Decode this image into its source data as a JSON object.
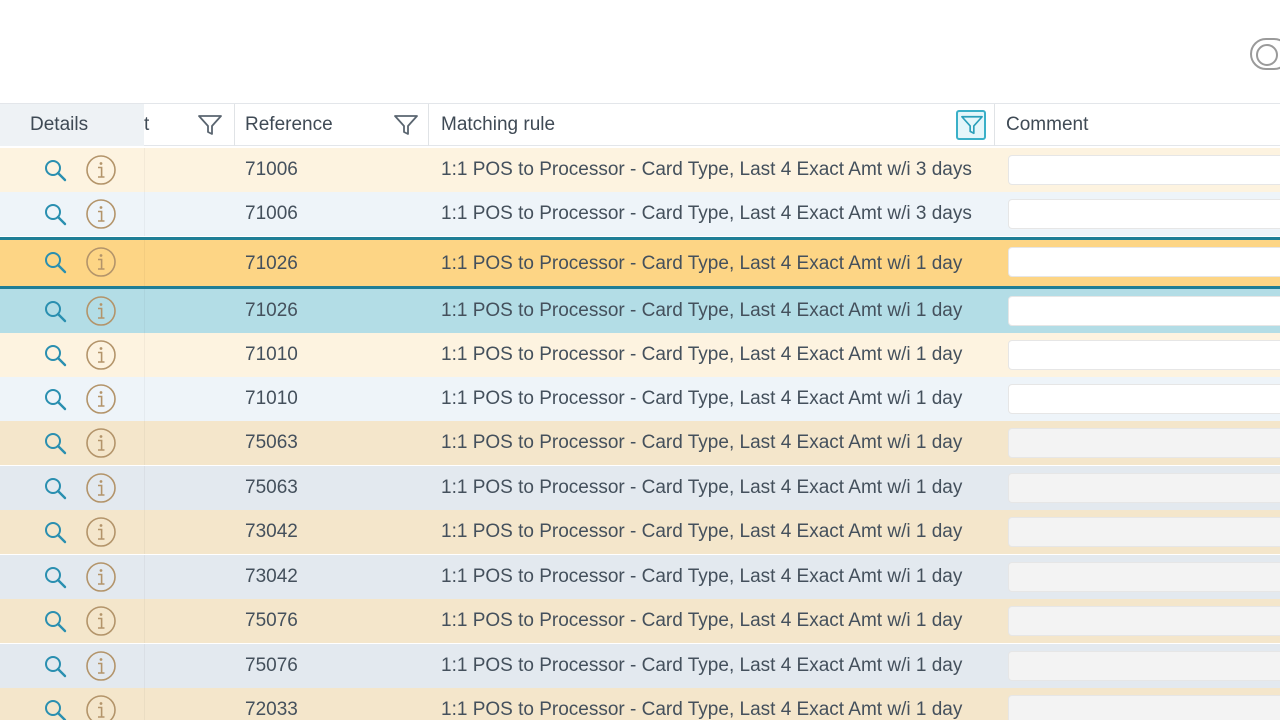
{
  "header": {
    "details_label": "Details",
    "partial_label": "t",
    "reference_label": "Reference",
    "matching_rule_label": "Matching rule",
    "comment_label": "Comment"
  },
  "colors": {
    "row_orange_light": "#fdf3e0",
    "row_blue_light": "#eef4f9",
    "row_orange_dark": "#f4e6cb",
    "row_blue_dark": "#e3e9ef",
    "row_selected_orange": "#fdd585",
    "row_selected_blue": "#b3dde6",
    "accent": "#1f7e96",
    "icon_blue": "#2a8fb0",
    "icon_orange": "#b3946a"
  },
  "rows": [
    {
      "reference": "71006",
      "matching_rule": "1:1 POS to Processor - Card Type, Last 4 Exact Amt w/i 3 days",
      "comment": ""
    },
    {
      "reference": "71006",
      "matching_rule": "1:1 POS to Processor - Card Type, Last 4 Exact Amt w/i 3 days",
      "comment": ""
    },
    {
      "reference": "71026",
      "matching_rule": "1:1 POS to Processor - Card Type, Last 4 Exact Amt w/i 1 day",
      "comment": ""
    },
    {
      "reference": "71026",
      "matching_rule": "1:1 POS to Processor - Card Type, Last 4 Exact Amt w/i 1 day",
      "comment": ""
    },
    {
      "reference": "71010",
      "matching_rule": "1:1 POS to Processor - Card Type, Last 4 Exact Amt w/i 1 day",
      "comment": ""
    },
    {
      "reference": "71010",
      "matching_rule": "1:1 POS to Processor - Card Type, Last 4 Exact Amt w/i 1 day",
      "comment": ""
    },
    {
      "reference": "75063",
      "matching_rule": "1:1 POS to Processor - Card Type, Last 4 Exact Amt w/i 1 day",
      "comment": ""
    },
    {
      "reference": "75063",
      "matching_rule": "1:1 POS to Processor - Card Type, Last 4 Exact Amt w/i 1 day",
      "comment": ""
    },
    {
      "reference": "73042",
      "matching_rule": "1:1 POS to Processor - Card Type, Last 4 Exact Amt w/i 1 day",
      "comment": ""
    },
    {
      "reference": "73042",
      "matching_rule": "1:1 POS to Processor - Card Type, Last 4 Exact Amt w/i 1 day",
      "comment": ""
    },
    {
      "reference": "75076",
      "matching_rule": "1:1 POS to Processor - Card Type, Last 4 Exact Amt w/i 1 day",
      "comment": ""
    },
    {
      "reference": "75076",
      "matching_rule": "1:1 POS to Processor - Card Type, Last 4 Exact Amt w/i 1 day",
      "comment": ""
    },
    {
      "reference": "72033",
      "matching_rule": "1:1 POS to Processor - Card Type, Last 4 Exact Amt w/i 1 day",
      "comment": ""
    }
  ]
}
